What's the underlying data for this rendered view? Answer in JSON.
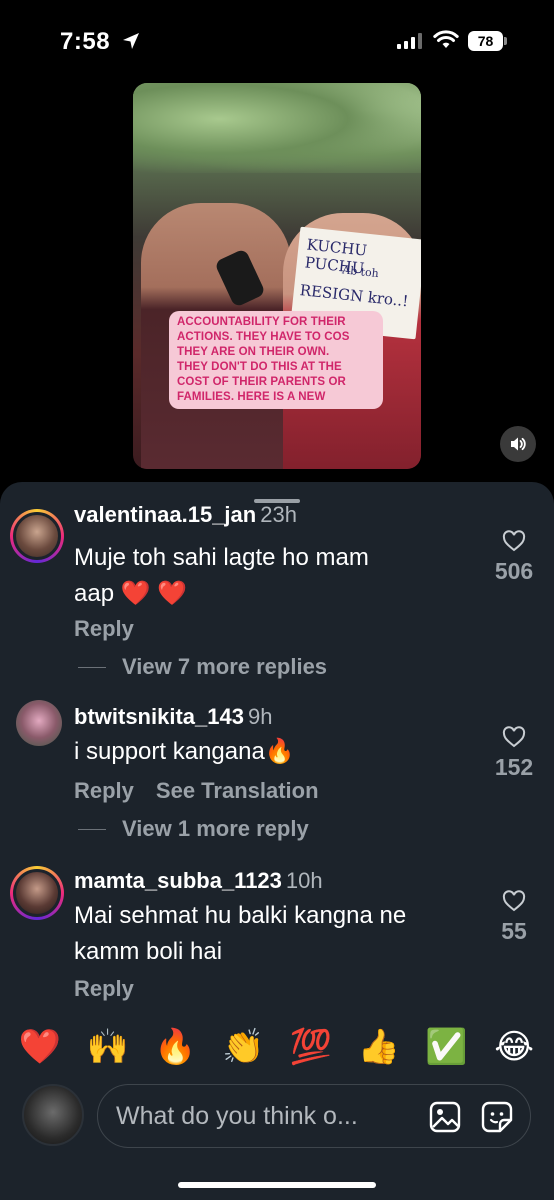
{
  "status_bar": {
    "time": "7:58",
    "battery": "78",
    "icons": [
      "location-arrow-icon",
      "signal-icon",
      "wifi-icon",
      "battery-icon"
    ]
  },
  "video": {
    "sign_lines": [
      "KUCHU PUCHU",
      "Ab toh",
      "RESIGN kro..!"
    ],
    "caption_lines": [
      "ACCOUNTABILITY FOR THEIR",
      "ACTIONS. THEY HAVE TO COS",
      "THEY ARE ON THEIR OWN.",
      "THEY DON'T DO THIS AT THE",
      "COST OF THEIR PARENTS OR",
      "FAMILIES. HERE IS A NEW"
    ],
    "mute_icon": "speaker-icon"
  },
  "comments": [
    {
      "username": "valentinaa.15_jan",
      "time": "23h",
      "lines": [
        "Muje toh sahi lagte ho mam",
        "aap ❤️ ❤️"
      ],
      "likes": "506",
      "actions": [
        "Reply"
      ],
      "view_more": "View 7 more replies"
    },
    {
      "username": "btwitsnikita_143",
      "time": "9h",
      "lines": [
        "i support kangana🔥"
      ],
      "likes": "152",
      "actions": [
        "Reply",
        "See Translation"
      ],
      "view_more": "View 1 more reply"
    },
    {
      "username": "mamta_subba_1123",
      "time": "10h",
      "lines": [
        "Mai sehmat hu balki kangna ne",
        "kamm boli hai"
      ],
      "likes": "55",
      "actions": [
        "Reply"
      ]
    }
  ],
  "emoji_bar": [
    "❤️",
    "🙌",
    "🔥",
    "👏",
    "💯",
    "👍",
    "✅",
    "😂"
  ],
  "composer": {
    "placeholder": "What do you think o...",
    "icons": [
      "image-icon",
      "sticker-icon"
    ]
  }
}
